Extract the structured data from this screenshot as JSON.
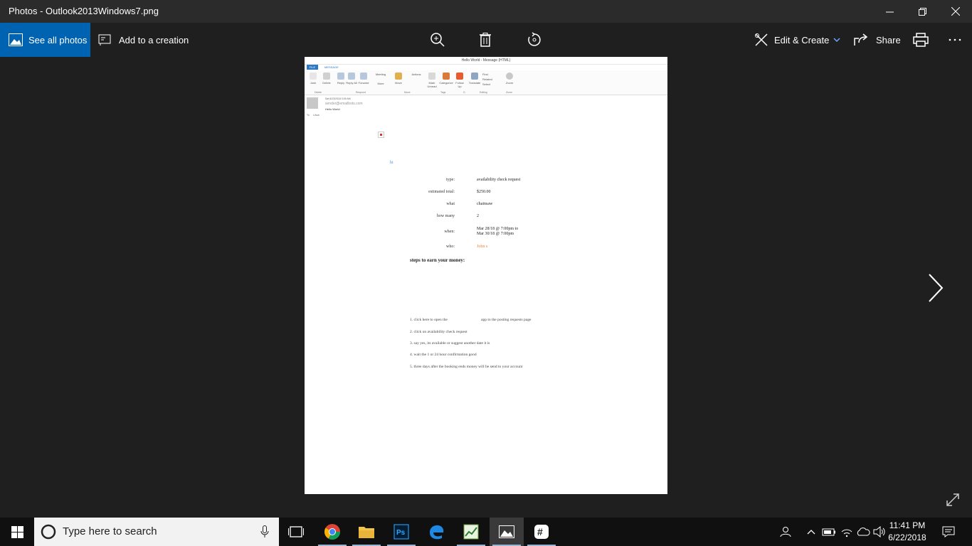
{
  "window": {
    "title": "Photos - Outlook2013Windows7.png"
  },
  "toolbar": {
    "see_all_label": "See all photos",
    "add_creation_label": "Add to a creation",
    "edit_create_label": "Edit & Create",
    "share_label": "Share"
  },
  "outlook": {
    "title": "Hello World - Message (HTML)",
    "tab_file": "FILE",
    "tab_message": "MESSAGE",
    "ribbon": {
      "junk": "Junk",
      "delete": "Delete",
      "reply": "Reply",
      "reply_all": "Reply All",
      "forward": "Forward",
      "meeting": "Meeting",
      "more": "More",
      "move": "Move",
      "actions": "Actions",
      "mark_unread": "Mark Unread",
      "categorize": "Categorize",
      "follow_up": "Follow Up",
      "translate": "Translate",
      "find": "Find",
      "related": "Related",
      "select": "Select",
      "zoom": "Zoom",
      "groups": [
        "Delete",
        "Respond",
        "Move",
        "Tags",
        "G",
        "Editing",
        "Zoom"
      ]
    },
    "header": {
      "date": "Sat 6/23/2018 3:09 AM",
      "from": "sender@emailbots.com",
      "subject": "Hello World",
      "to_label": "To",
      "to_value": "Lihua"
    },
    "body": {
      "greeting": "hi",
      "fields": [
        {
          "label": "type:",
          "value": "availability check request"
        },
        {
          "label": "estimated total:",
          "value": "$250.00"
        },
        {
          "label": "what",
          "value": "chainsaw"
        },
        {
          "label": "how many",
          "value": "2"
        },
        {
          "label": "when:",
          "value": "Mar 28/18 @ 7:00pm to",
          "value2": "Mar 30/18 @ 7:00pm"
        },
        {
          "label": "who:",
          "value": "John s"
        }
      ],
      "steps_heading": "steps to earn your money:",
      "steps": [
        "1. click here to open the",
        "app to the posting requests page",
        "2. click on availability check request",
        "3. say yes, its available or suggest another date it is",
        "4. wait the 1 or 24 hour confirmation good",
        "5. three days after the booking ends money will be send to your account"
      ]
    }
  },
  "taskbar": {
    "search_placeholder": "Type here to search",
    "time": "11:41 PM",
    "date": "6/22/2018"
  },
  "colors": {
    "accent": "#0063b1",
    "outlook_blue": "#2b78c5",
    "link_orange": "#e8833a",
    "link_blue": "#4a90d9"
  }
}
